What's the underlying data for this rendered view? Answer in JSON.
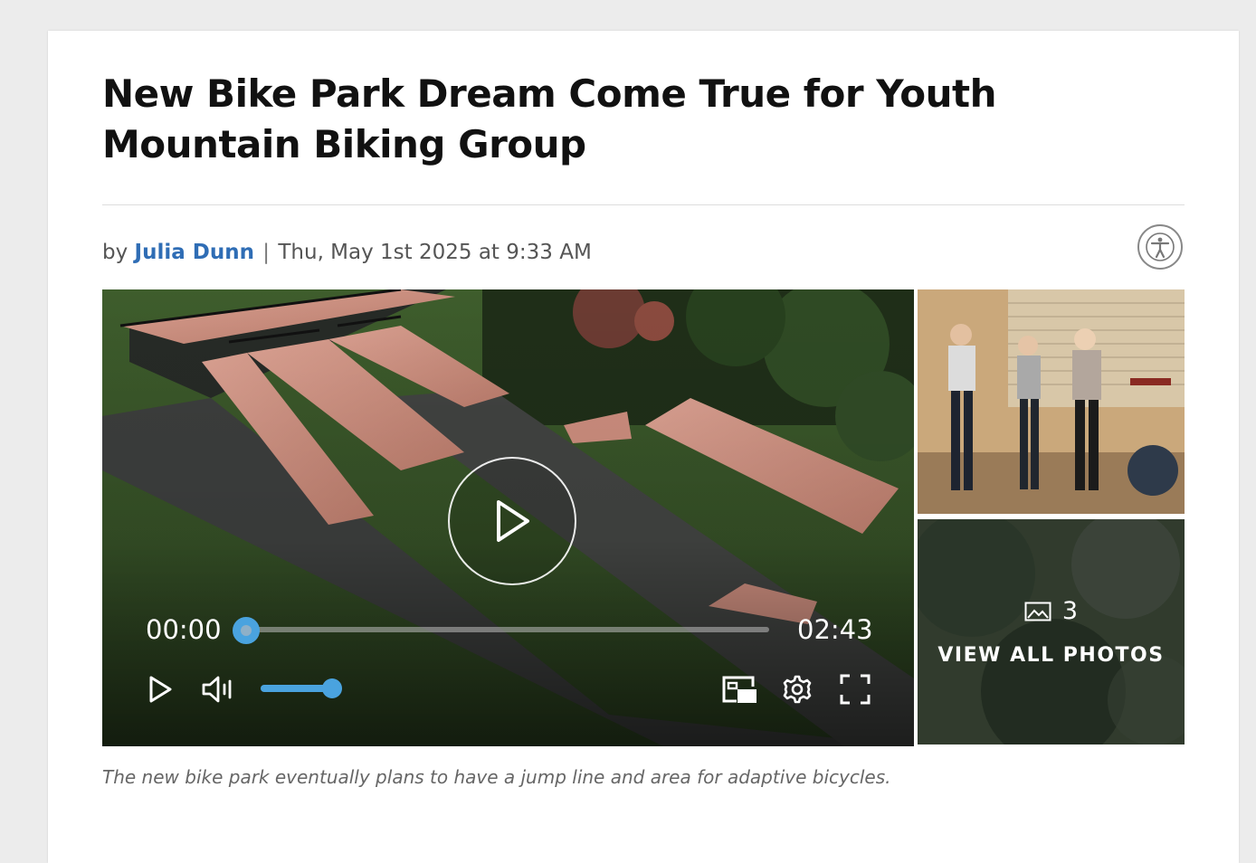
{
  "article": {
    "title": "New Bike Park Dream Come True for Youth Mountain Biking Group",
    "byline_prefix": "by",
    "author": "Julia Dunn",
    "separator": "|",
    "date": "Thu, May 1st 2025 at 9:33 AM",
    "caption": "The new bike park eventually plans to have a jump line and area for adaptive bicycles."
  },
  "video": {
    "current_time": "00:00",
    "duration": "02:43",
    "progress_fraction": 0.0,
    "volume_fraction": 1.0
  },
  "gallery": {
    "photo_count": "3",
    "view_all_label": "VIEW ALL PHOTOS"
  },
  "icons": {
    "accessibility": "accessibility-icon",
    "play": "play-icon",
    "mute": "volume-icon",
    "pip": "picture-in-picture-icon",
    "settings": "gear-icon",
    "fullscreen": "fullscreen-icon",
    "photos": "image-icon"
  },
  "colors": {
    "author_link": "#2f6db5",
    "player_accent": "#4aa3df"
  }
}
